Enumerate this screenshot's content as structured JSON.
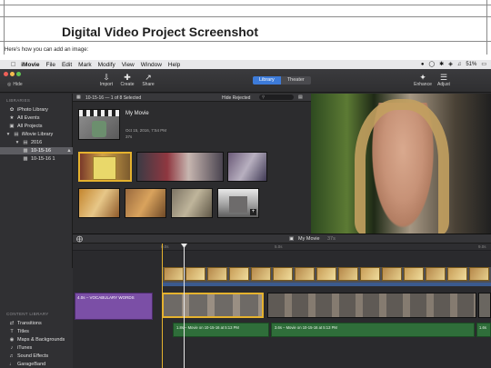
{
  "doc": {
    "title": "Digital Video Project Screenshot",
    "subtitle": "Here's how you can add an image:"
  },
  "menubar": {
    "app": "iMovie",
    "items": [
      "File",
      "Edit",
      "Mark",
      "Modify",
      "View",
      "Window",
      "Help"
    ],
    "battery": "51%"
  },
  "toolbar": {
    "hide_label": "Hide",
    "import_label": "Import",
    "create_label": "Create",
    "share_label": "Share",
    "library_tab": "Library",
    "theater_tab": "Theater",
    "enhance_label": "Enhance",
    "adjust_label": "Adjust"
  },
  "sidebar": {
    "libraries_header": "LIBRARIES",
    "items": [
      {
        "label": "iPhoto Library",
        "icon": "photo-icon"
      },
      {
        "label": "All Events",
        "icon": "star-icon"
      },
      {
        "label": "All Projects",
        "icon": "film-icon"
      },
      {
        "label": "iMovie Library",
        "icon": "library-icon"
      },
      {
        "label": "2016",
        "icon": "folder-icon"
      },
      {
        "label": "10-15-16",
        "icon": "event-icon"
      },
      {
        "label": "10-15-16 1",
        "icon": "event-icon"
      }
    ],
    "content_header": "CONTENT LIBRARY",
    "content_items": [
      {
        "label": "Transitions",
        "icon": "transitions-icon"
      },
      {
        "label": "Titles",
        "icon": "titles-icon"
      },
      {
        "label": "Maps & Backgrounds",
        "icon": "globe-icon"
      },
      {
        "label": "iTunes",
        "icon": "music-icon"
      },
      {
        "label": "Sound Effects",
        "icon": "speaker-icon"
      },
      {
        "label": "GarageBand",
        "icon": "guitar-icon"
      }
    ]
  },
  "browser": {
    "header_left": "10-15-16 — 1 of 8 Selected",
    "hide_rejected": "Hide Rejected",
    "movie_name": "My Movie",
    "movie_date": "Oct 15, 2016, 7:54 PM",
    "movie_duration": "37s"
  },
  "timeline": {
    "project_name": "My Movie",
    "project_duration": "37s",
    "ruler": [
      "0.0s",
      "5.0s",
      "9.0s"
    ],
    "title_clip": "4.0s – VOCABULARY WORDS",
    "audio_1": "1.8s – Movie on 10-15-16 at 5:13 PM",
    "audio_2": "3.6s – Movie on 10-15-16 at 5:13 PM",
    "audio_3": "1.6s"
  },
  "colors": {
    "accent": "#3d7bd9",
    "clip_border": "#e5b22e",
    "audio": "#2f6e3a",
    "title_clip": "#7b4fa6"
  }
}
